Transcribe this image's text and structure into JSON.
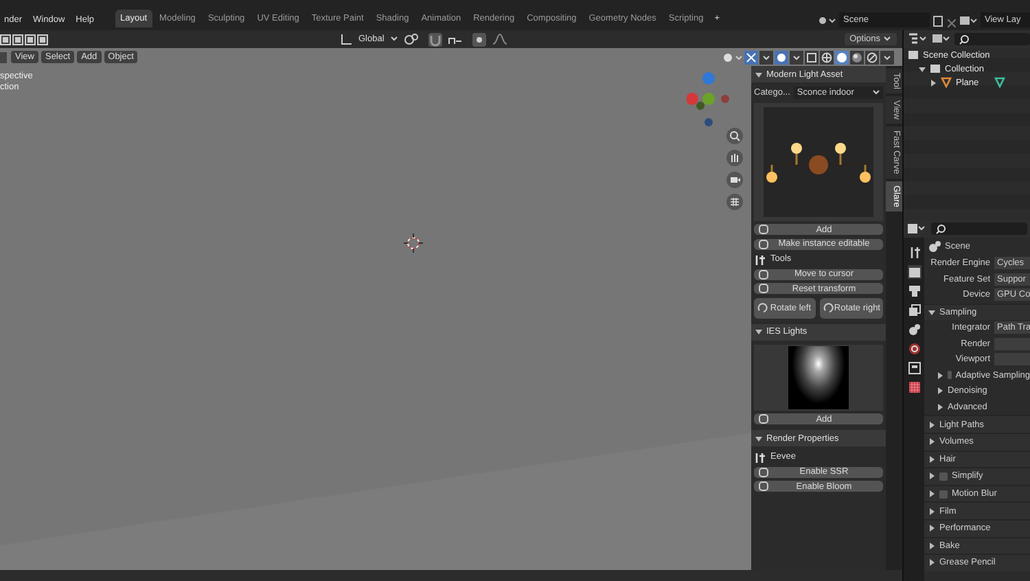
{
  "topbar": {
    "menus": [
      "nder",
      "Window",
      "Help"
    ],
    "workspaces": [
      {
        "label": "Layout",
        "selected": true
      },
      {
        "label": "Modeling",
        "selected": false
      },
      {
        "label": "Sculpting",
        "selected": false
      },
      {
        "label": "UV Editing",
        "selected": false
      },
      {
        "label": "Texture Paint",
        "selected": false
      },
      {
        "label": "Shading",
        "selected": false
      },
      {
        "label": "Animation",
        "selected": false
      },
      {
        "label": "Rendering",
        "selected": false
      },
      {
        "label": "Compositing",
        "selected": false
      },
      {
        "label": "Geometry Nodes",
        "selected": false
      },
      {
        "label": "Scripting",
        "selected": false
      }
    ],
    "add_workspace": "+",
    "scene": "Scene",
    "view_layer": "View Lay"
  },
  "viewport": {
    "orientation": "Global",
    "options": "Options",
    "menus": [
      "View",
      "Select",
      "Add",
      "Object"
    ],
    "overlay_lines": [
      "spective",
      "ction"
    ]
  },
  "sidebar": {
    "tabs": [
      {
        "label": "Tool",
        "selected": false
      },
      {
        "label": "View",
        "selected": false
      },
      {
        "label": "Fast Carve",
        "selected": false
      },
      {
        "label": "Glare",
        "selected": true
      }
    ],
    "panels": [
      {
        "title": "Modern Light Asset",
        "expanded": true,
        "items": [
          {
            "kind": "dropdown",
            "label": "Catego...",
            "value": "Sconce indoor"
          },
          {
            "kind": "sconce"
          },
          {
            "kind": "button",
            "label": "Add"
          },
          {
            "kind": "button",
            "label": "Make instance editable"
          },
          {
            "kind": "heading",
            "label": "Tools"
          },
          {
            "kind": "button",
            "label": "Move to cursor"
          },
          {
            "kind": "button",
            "label": "Reset transform"
          },
          {
            "kind": "pair",
            "buttons": [
              "Rotate left",
              "Rotate right"
            ]
          }
        ]
      },
      {
        "title": "IES Lights",
        "expanded": true,
        "items": [
          {
            "kind": "spotlight"
          },
          {
            "kind": "button",
            "label": "Add"
          }
        ]
      },
      {
        "title": "Render Properties",
        "expanded": true,
        "items": [
          {
            "kind": "heading",
            "label": "Eevee"
          },
          {
            "kind": "button",
            "label": "Enable SSR"
          },
          {
            "kind": "button",
            "label": "Enable Bloom"
          }
        ]
      }
    ]
  },
  "outliner": {
    "tree": [
      {
        "label": "Scene Collection",
        "children": [
          {
            "label": "Collection",
            "expanded": true,
            "children": [
              {
                "label": "Plane",
                "expanded": false
              }
            ]
          }
        ]
      }
    ]
  },
  "properties": {
    "header": "Scene",
    "fields": [
      {
        "label": "Render Engine",
        "value": "Cycles"
      },
      {
        "label": "Feature Set",
        "value": "Suppor"
      },
      {
        "label": "Device",
        "value": "GPU Co"
      }
    ],
    "panels": [
      {
        "kind": "panel",
        "title": "Sampling",
        "expanded": true,
        "fields": [
          {
            "label": "Integrator",
            "value": "Path Tra"
          },
          {
            "label": "Render"
          },
          {
            "label": "Viewport"
          }
        ],
        "subpanels": [
          {
            "kind": "toggle",
            "title": "Adaptive Sampling",
            "checked": false,
            "expanded": false
          },
          {
            "kind": "panel",
            "title": "Denoising",
            "expanded": false
          },
          {
            "kind": "panel",
            "title": "Advanced",
            "expanded": false
          }
        ]
      },
      {
        "kind": "panel",
        "title": "Light Paths",
        "expanded": false
      },
      {
        "kind": "panel",
        "title": "Volumes",
        "expanded": false
      },
      {
        "kind": "panel",
        "title": "Hair",
        "expanded": false
      },
      {
        "kind": "toggle",
        "title": "Simplify",
        "checked": false,
        "expanded": false
      },
      {
        "kind": "toggle",
        "title": "Motion Blur",
        "checked": false,
        "expanded": false
      },
      {
        "kind": "panel",
        "title": "Film",
        "expanded": false
      },
      {
        "kind": "panel",
        "title": "Performance",
        "expanded": false
      },
      {
        "kind": "panel",
        "title": "Bake",
        "expanded": false
      },
      {
        "kind": "panel",
        "title": "Grease Pencil",
        "expanded": false
      }
    ]
  }
}
